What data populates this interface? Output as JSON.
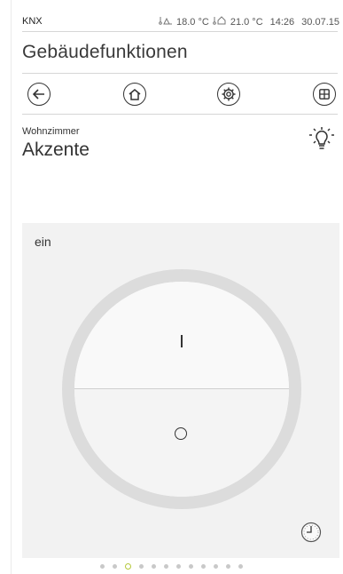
{
  "status_bar": {
    "brand": "KNX",
    "outdoor_temp": "18.0 °C",
    "indoor_temp": "21.0 °C",
    "time": "14:26",
    "date": "30.07.15"
  },
  "page": {
    "title": "Gebäudefunktionen"
  },
  "nav": {
    "items": [
      {
        "name": "back-icon"
      },
      {
        "name": "home-icon"
      },
      {
        "name": "settings-gear-icon"
      },
      {
        "name": "grid-icon"
      }
    ]
  },
  "function": {
    "room": "Wohnzimmer",
    "name": "Akzente",
    "icon": "lightbulb-icon"
  },
  "switch": {
    "state": "ein",
    "on_symbol": "I",
    "off_symbol": "O"
  },
  "pagination": {
    "total": 12,
    "active": 3
  },
  "colors": {
    "accent": "#b5c83a",
    "panel": "#f2f2f2",
    "ring": "#dcdcdc"
  }
}
